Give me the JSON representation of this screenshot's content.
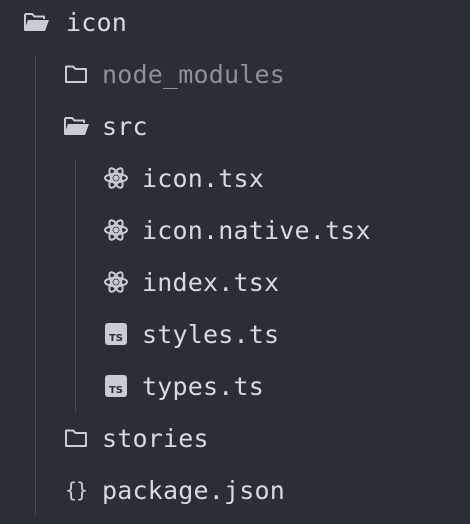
{
  "tree": {
    "root": {
      "label": "icon",
      "icon": "folder-open-icon"
    },
    "items": [
      {
        "label": "node_modules",
        "icon": "folder-icon",
        "dimmed": true
      },
      {
        "label": "src",
        "icon": "folder-open-icon"
      },
      {
        "label": "icon.tsx",
        "icon": "react-icon"
      },
      {
        "label": "icon.native.tsx",
        "icon": "react-icon"
      },
      {
        "label": "index.tsx",
        "icon": "react-icon"
      },
      {
        "label": "styles.ts",
        "icon": "typescript-icon",
        "badge": "TS"
      },
      {
        "label": "types.ts",
        "icon": "typescript-icon",
        "badge": "TS"
      },
      {
        "label": "stories",
        "icon": "folder-icon"
      },
      {
        "label": "package.json",
        "icon": "json-braces-icon",
        "glyph": "{}"
      }
    ]
  },
  "colors": {
    "background": "#2b2e36",
    "text": "#d7dae0",
    "dimmed_text": "#8b909a",
    "icon": "#c8ccd4",
    "guide_line": "#444852"
  }
}
